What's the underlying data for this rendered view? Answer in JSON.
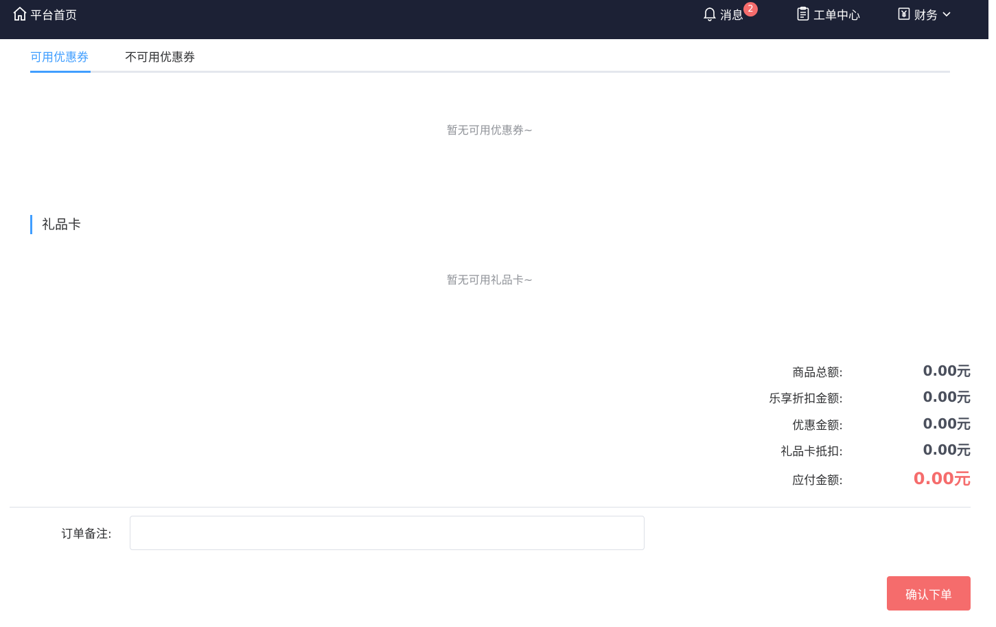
{
  "nav": {
    "home_label": "平台首页",
    "messages_label": "消息",
    "messages_badge": "2",
    "ticket_label": "工单中心",
    "finance_label": "财务"
  },
  "coupon_tabs": {
    "available": "可用优惠券",
    "unavailable": "不可用优惠券",
    "empty_text": "暂无可用优惠券~"
  },
  "gift_card": {
    "title": "礼品卡",
    "empty_text": "暂无可用礼品卡~"
  },
  "summary": [
    {
      "label": "商品总额:",
      "value": "0.00元"
    },
    {
      "label": "乐享折扣金额:",
      "value": "0.00元"
    },
    {
      "label": "优惠金额:",
      "value": "0.00元"
    },
    {
      "label": "礼品卡抵扣:",
      "value": "0.00元"
    },
    {
      "label": "应付金额:",
      "value": "0.00元"
    }
  ],
  "remark": {
    "label": "订单备注:",
    "value": "",
    "placeholder": ""
  },
  "confirm_button": "确认下单",
  "colors": {
    "topbar": "#1c2135",
    "accent": "#409eff",
    "danger": "#f56c6c"
  }
}
